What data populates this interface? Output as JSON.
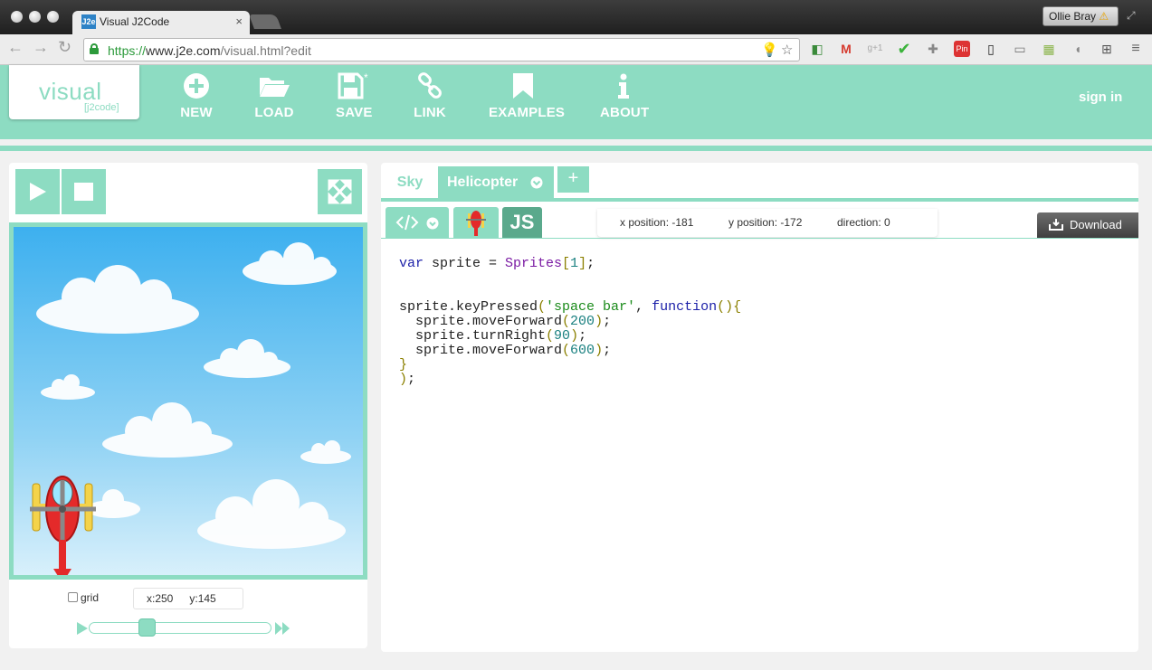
{
  "browser": {
    "tab_title": "Visual J2Code",
    "tab_favicon": "J2e",
    "url_scheme": "https://",
    "url_domain": "www.j2e.com",
    "url_path": "/visual.html?edit",
    "user_name": "Ollie Bray",
    "warning_glyph": "⚠"
  },
  "app": {
    "logo_main": "visual",
    "logo_sub": "[j2code]",
    "menu": [
      {
        "label": "NEW",
        "icon": "plus-circle-icon"
      },
      {
        "label": "LOAD",
        "icon": "folder-icon"
      },
      {
        "label": "SAVE",
        "icon": "floppy-disk-icon"
      },
      {
        "label": "LINK",
        "icon": "link-icon"
      },
      {
        "label": "EXAMPLES",
        "icon": "bookmark-icon"
      },
      {
        "label": "ABOUT",
        "icon": "info-icon"
      }
    ],
    "signin": "sign in",
    "accent_color": "#8ddcc2"
  },
  "stage": {
    "grid_label": "grid",
    "grid_checked": false,
    "x_coord": "x:250",
    "y_coord": "y:145",
    "speed_level": 0.3
  },
  "editor": {
    "sprite_tabs": [
      {
        "label": "Sky",
        "active": false
      },
      {
        "label": "Helicopter",
        "active": true
      }
    ],
    "add_tab_label": "+",
    "js_label": "JS",
    "x_position": "x position: -181",
    "y_position": "y position: -172",
    "direction": "direction: 0",
    "download_label": "Download",
    "code_lines": [
      "var sprite = Sprites[1];",
      "",
      "",
      "sprite.keyPressed('space bar', function(){",
      "  sprite.moveForward(200);",
      "  sprite.turnRight(90);",
      "  sprite.moveForward(600);",
      "}",
      ");"
    ]
  }
}
